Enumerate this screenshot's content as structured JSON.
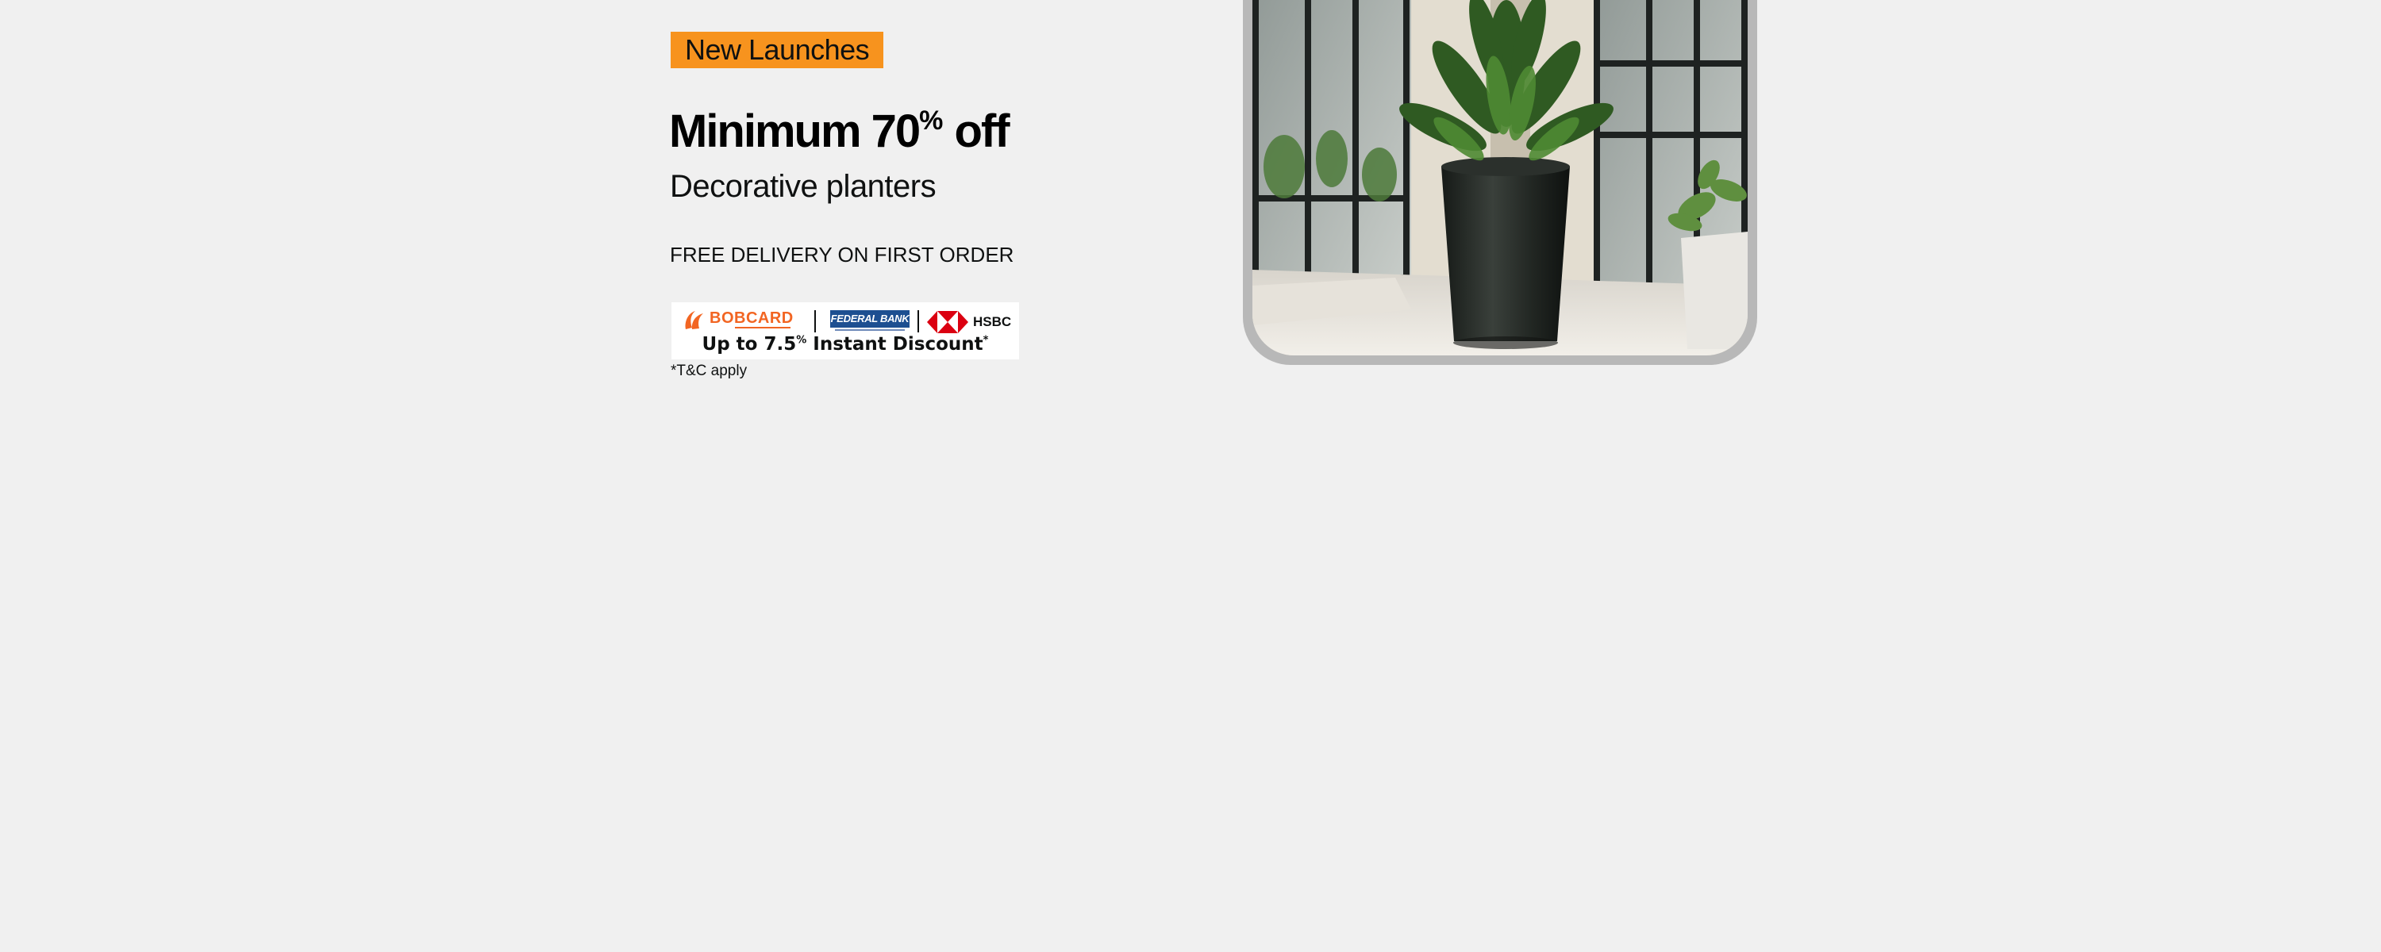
{
  "promo": {
    "badge_label": "New Launches",
    "headline_main": "Minimum 70",
    "headline_percent": "%",
    "headline_suffix": " off",
    "subheadline": "Decorative planters",
    "delivery_note": "FREE DELIVERY ON FIRST ORDER"
  },
  "bank_offer": {
    "banks": [
      {
        "name": "BOBCARD",
        "icon": "bobcard-logo-icon"
      },
      {
        "name": "FEDERAL BANK",
        "icon": "federal-bank-logo-icon"
      },
      {
        "name": "HSBC",
        "icon": "hsbc-logo-icon"
      }
    ],
    "discount_main": "Up to 7.5",
    "discount_percent": "%",
    "discount_suffix": " Instant Discount",
    "discount_asterisk": "*",
    "terms": "*T&C apply"
  },
  "product_image": {
    "description_icon": "potted-plant-image"
  },
  "colors": {
    "background": "#f0f0f0",
    "badge": "#f7931e",
    "bobcard_orange": "#f26522",
    "federal_blue": "#1d4f91",
    "hsbc_red": "#db0011"
  }
}
